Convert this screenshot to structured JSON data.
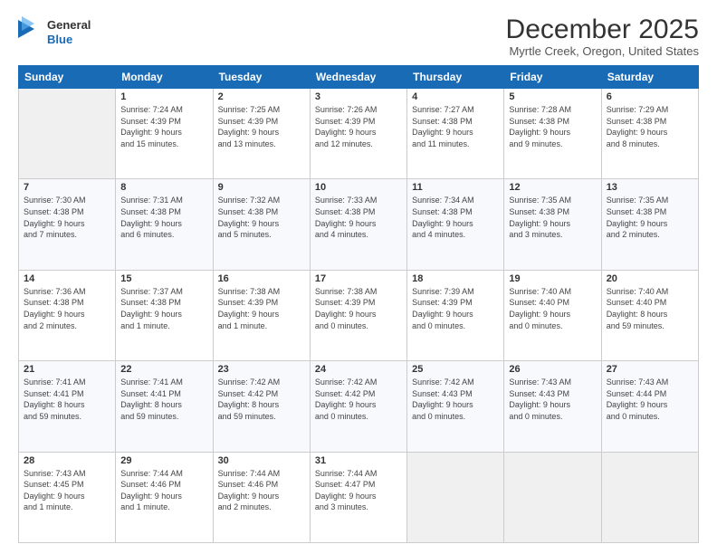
{
  "logo": {
    "line1": "General",
    "line2": "Blue"
  },
  "title": "December 2025",
  "subtitle": "Myrtle Creek, Oregon, United States",
  "weekdays": [
    "Sunday",
    "Monday",
    "Tuesday",
    "Wednesday",
    "Thursday",
    "Friday",
    "Saturday"
  ],
  "weeks": [
    [
      {
        "day": "",
        "info": ""
      },
      {
        "day": "1",
        "info": "Sunrise: 7:24 AM\nSunset: 4:39 PM\nDaylight: 9 hours\nand 15 minutes."
      },
      {
        "day": "2",
        "info": "Sunrise: 7:25 AM\nSunset: 4:39 PM\nDaylight: 9 hours\nand 13 minutes."
      },
      {
        "day": "3",
        "info": "Sunrise: 7:26 AM\nSunset: 4:39 PM\nDaylight: 9 hours\nand 12 minutes."
      },
      {
        "day": "4",
        "info": "Sunrise: 7:27 AM\nSunset: 4:38 PM\nDaylight: 9 hours\nand 11 minutes."
      },
      {
        "day": "5",
        "info": "Sunrise: 7:28 AM\nSunset: 4:38 PM\nDaylight: 9 hours\nand 9 minutes."
      },
      {
        "day": "6",
        "info": "Sunrise: 7:29 AM\nSunset: 4:38 PM\nDaylight: 9 hours\nand 8 minutes."
      }
    ],
    [
      {
        "day": "7",
        "info": "Sunrise: 7:30 AM\nSunset: 4:38 PM\nDaylight: 9 hours\nand 7 minutes."
      },
      {
        "day": "8",
        "info": "Sunrise: 7:31 AM\nSunset: 4:38 PM\nDaylight: 9 hours\nand 6 minutes."
      },
      {
        "day": "9",
        "info": "Sunrise: 7:32 AM\nSunset: 4:38 PM\nDaylight: 9 hours\nand 5 minutes."
      },
      {
        "day": "10",
        "info": "Sunrise: 7:33 AM\nSunset: 4:38 PM\nDaylight: 9 hours\nand 4 minutes."
      },
      {
        "day": "11",
        "info": "Sunrise: 7:34 AM\nSunset: 4:38 PM\nDaylight: 9 hours\nand 4 minutes."
      },
      {
        "day": "12",
        "info": "Sunrise: 7:35 AM\nSunset: 4:38 PM\nDaylight: 9 hours\nand 3 minutes."
      },
      {
        "day": "13",
        "info": "Sunrise: 7:35 AM\nSunset: 4:38 PM\nDaylight: 9 hours\nand 2 minutes."
      }
    ],
    [
      {
        "day": "14",
        "info": "Sunrise: 7:36 AM\nSunset: 4:38 PM\nDaylight: 9 hours\nand 2 minutes."
      },
      {
        "day": "15",
        "info": "Sunrise: 7:37 AM\nSunset: 4:38 PM\nDaylight: 9 hours\nand 1 minute."
      },
      {
        "day": "16",
        "info": "Sunrise: 7:38 AM\nSunset: 4:39 PM\nDaylight: 9 hours\nand 1 minute."
      },
      {
        "day": "17",
        "info": "Sunrise: 7:38 AM\nSunset: 4:39 PM\nDaylight: 9 hours\nand 0 minutes."
      },
      {
        "day": "18",
        "info": "Sunrise: 7:39 AM\nSunset: 4:39 PM\nDaylight: 9 hours\nand 0 minutes."
      },
      {
        "day": "19",
        "info": "Sunrise: 7:40 AM\nSunset: 4:40 PM\nDaylight: 9 hours\nand 0 minutes."
      },
      {
        "day": "20",
        "info": "Sunrise: 7:40 AM\nSunset: 4:40 PM\nDaylight: 8 hours\nand 59 minutes."
      }
    ],
    [
      {
        "day": "21",
        "info": "Sunrise: 7:41 AM\nSunset: 4:41 PM\nDaylight: 8 hours\nand 59 minutes."
      },
      {
        "day": "22",
        "info": "Sunrise: 7:41 AM\nSunset: 4:41 PM\nDaylight: 8 hours\nand 59 minutes."
      },
      {
        "day": "23",
        "info": "Sunrise: 7:42 AM\nSunset: 4:42 PM\nDaylight: 8 hours\nand 59 minutes."
      },
      {
        "day": "24",
        "info": "Sunrise: 7:42 AM\nSunset: 4:42 PM\nDaylight: 9 hours\nand 0 minutes."
      },
      {
        "day": "25",
        "info": "Sunrise: 7:42 AM\nSunset: 4:43 PM\nDaylight: 9 hours\nand 0 minutes."
      },
      {
        "day": "26",
        "info": "Sunrise: 7:43 AM\nSunset: 4:43 PM\nDaylight: 9 hours\nand 0 minutes."
      },
      {
        "day": "27",
        "info": "Sunrise: 7:43 AM\nSunset: 4:44 PM\nDaylight: 9 hours\nand 0 minutes."
      }
    ],
    [
      {
        "day": "28",
        "info": "Sunrise: 7:43 AM\nSunset: 4:45 PM\nDaylight: 9 hours\nand 1 minute."
      },
      {
        "day": "29",
        "info": "Sunrise: 7:44 AM\nSunset: 4:46 PM\nDaylight: 9 hours\nand 1 minute."
      },
      {
        "day": "30",
        "info": "Sunrise: 7:44 AM\nSunset: 4:46 PM\nDaylight: 9 hours\nand 2 minutes."
      },
      {
        "day": "31",
        "info": "Sunrise: 7:44 AM\nSunset: 4:47 PM\nDaylight: 9 hours\nand 3 minutes."
      },
      {
        "day": "",
        "info": ""
      },
      {
        "day": "",
        "info": ""
      },
      {
        "day": "",
        "info": ""
      }
    ]
  ]
}
